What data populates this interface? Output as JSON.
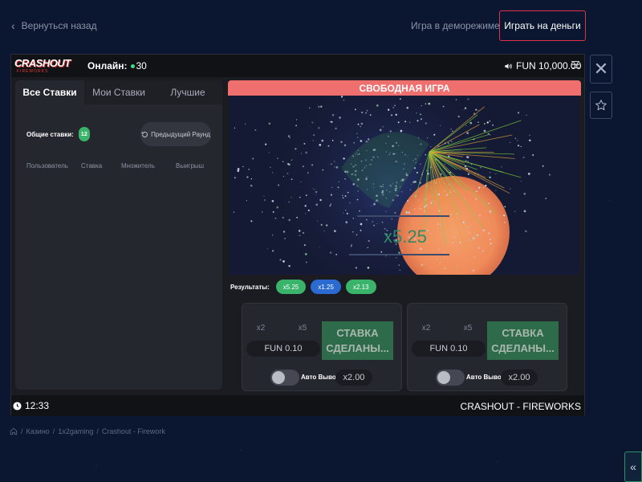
{
  "nav": {
    "back_label": "Вернуться назад",
    "demo_label": "Игра в деморежиме",
    "real_label": "Играть на деньги"
  },
  "header": {
    "logo_main": "CRASHOUT",
    "logo_sub": "FIREWORKS",
    "online_label": "Онлайн:",
    "online_count": "30",
    "balance": "FUN 10,000.00"
  },
  "bets": {
    "tabs": [
      {
        "label": "Все Ставки"
      },
      {
        "label": "Мои Ставки"
      },
      {
        "label": "Лучшие"
      }
    ],
    "total_label": "Общие ставки:",
    "total_count": "12",
    "prev_round_label": "Предыдущий Раунд",
    "columns": [
      "Пользователь",
      "Ставка",
      "Множитель",
      "Выигрыш"
    ]
  },
  "play": {
    "banner": "СВОБОДНАЯ ИГРА",
    "multiplier": "x5.25",
    "results_label": "Результаты:",
    "results": [
      {
        "label": "x5.25",
        "color": "#3bb46b"
      },
      {
        "label": "x1.25",
        "color": "#2b6bd1"
      },
      {
        "label": "x2.13",
        "color": "#3bb46b"
      }
    ]
  },
  "betboxes": [
    {
      "q1": "x2",
      "q2": "x5",
      "amount": "FUN 0.10",
      "place_line1": "СТАВКА",
      "place_line2": "СДЕЛАНЫ...",
      "auto_label": "Авто Вывод",
      "auto_value": "x2.00"
    },
    {
      "q1": "x2",
      "q2": "x5",
      "amount": "FUN 0.10",
      "place_line1": "СТАВКА",
      "place_line2": "СДЕЛАНЫ...",
      "auto_label": "Авто Вывод",
      "auto_value": "x2.00"
    }
  ],
  "footer": {
    "time": "12:33",
    "brand": "CRASHOUT - FIREWORKS"
  },
  "breadcrumb": [
    "Казино",
    "1x2gaming",
    "Crashout - Firework"
  ],
  "colors": {
    "accent": "#e0334a",
    "banner": "#ef6e6e",
    "green": "#3bb46b",
    "blue": "#2b6bd1"
  }
}
